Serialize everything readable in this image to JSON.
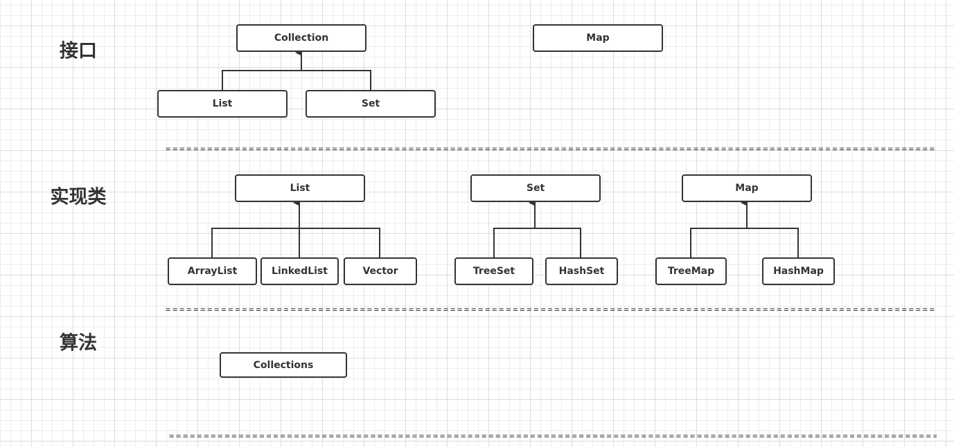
{
  "sections": {
    "interface": "接口",
    "impl": "实现类",
    "algorithm": "算法"
  },
  "interfaces": {
    "collection": "Collection",
    "map": "Map",
    "list": "List",
    "set": "Set"
  },
  "impl": {
    "list": "List",
    "set": "Set",
    "map": "Map",
    "arraylist": "ArrayList",
    "linkedlist": "LinkedList",
    "vector": "Vector",
    "treeset": "TreeSet",
    "hashset": "HashSet",
    "treemap": "TreeMap",
    "hashmap": "HashMap"
  },
  "algorithm": {
    "collections": "Collections"
  },
  "separator": "==============================================================================================================="
}
